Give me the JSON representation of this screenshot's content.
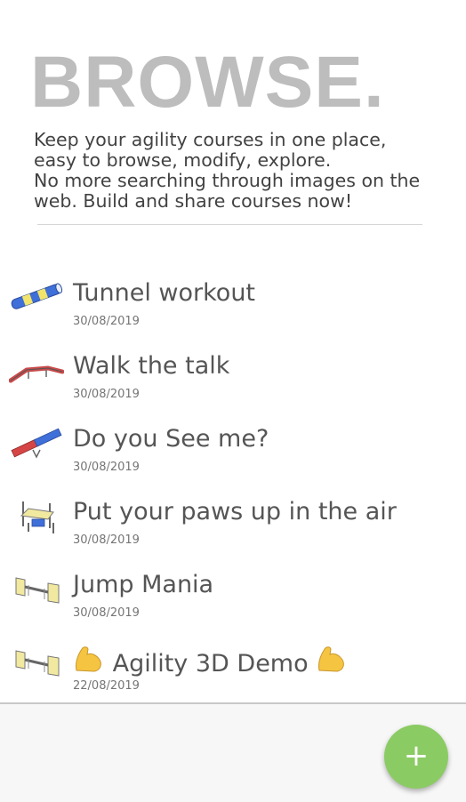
{
  "hero": {
    "title": "BROWSE.",
    "description_lines": [
      "Keep your agility courses in one place,",
      "easy to browse, modify, explore.",
      "No more searching through images on the",
      "web. Build and share courses now!"
    ]
  },
  "courses": [
    {
      "title": "Tunnel workout",
      "date": "30/08/2019",
      "icon": "tunnel-icon"
    },
    {
      "title": "Walk the talk",
      "date": "30/08/2019",
      "icon": "dogwalk-icon"
    },
    {
      "title": "Do you See me?",
      "date": "30/08/2019",
      "icon": "seesaw-icon"
    },
    {
      "title": "Put your paws up in the air",
      "date": "30/08/2019",
      "icon": "table-icon"
    },
    {
      "title": "Jump Mania",
      "date": "30/08/2019",
      "icon": "jump-icon"
    },
    {
      "title": "Agility 3D Demo",
      "date": "22/08/2019",
      "icon": "jump-icon"
    }
  ],
  "fab": {
    "label": "+",
    "color": "#8bcb63"
  }
}
